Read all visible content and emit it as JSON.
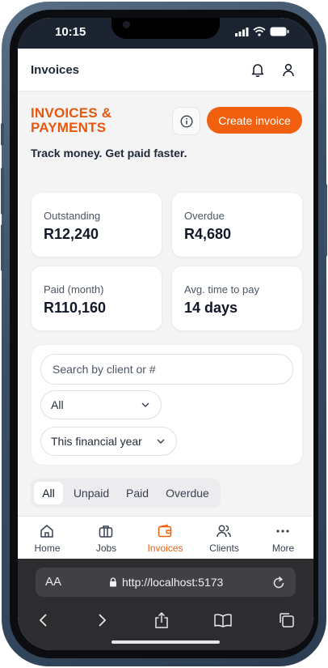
{
  "status_bar": {
    "time": "10:15"
  },
  "app_bar": {
    "title": "Invoices",
    "bell_icon": "bell-icon",
    "user_icon": "user-icon"
  },
  "hero": {
    "title": "INVOICES & PAYMENTS",
    "info_icon": "info-icon",
    "create_button": "Create invoice",
    "tagline": "Track money. Get paid faster.",
    "accent_color": "#f0600e"
  },
  "stats": [
    {
      "label": "Outstanding",
      "value": "R12,240"
    },
    {
      "label": "Overdue",
      "value": "R4,680"
    },
    {
      "label": "Paid (month)",
      "value": "R110,160"
    },
    {
      "label": "Avg. time to pay",
      "value": "14 days"
    }
  ],
  "filters": {
    "search_placeholder": "Search by client or #",
    "search_value": "",
    "status_select": "All",
    "period_select": "This financial year"
  },
  "tabs": [
    {
      "label": "All",
      "active": true
    },
    {
      "label": "Unpaid",
      "active": false
    },
    {
      "label": "Paid",
      "active": false
    },
    {
      "label": "Overdue",
      "active": false
    }
  ],
  "nav": [
    {
      "label": "Home",
      "icon": "home-icon",
      "active": false
    },
    {
      "label": "Jobs",
      "icon": "briefcase-icon",
      "active": false
    },
    {
      "label": "Invoices",
      "icon": "wallet-icon",
      "active": true
    },
    {
      "label": "Clients",
      "icon": "users-icon",
      "active": false
    },
    {
      "label": "More",
      "icon": "more-icon",
      "active": false
    }
  ],
  "browser": {
    "aa_label": "AA",
    "url": "http://localhost:5173"
  }
}
